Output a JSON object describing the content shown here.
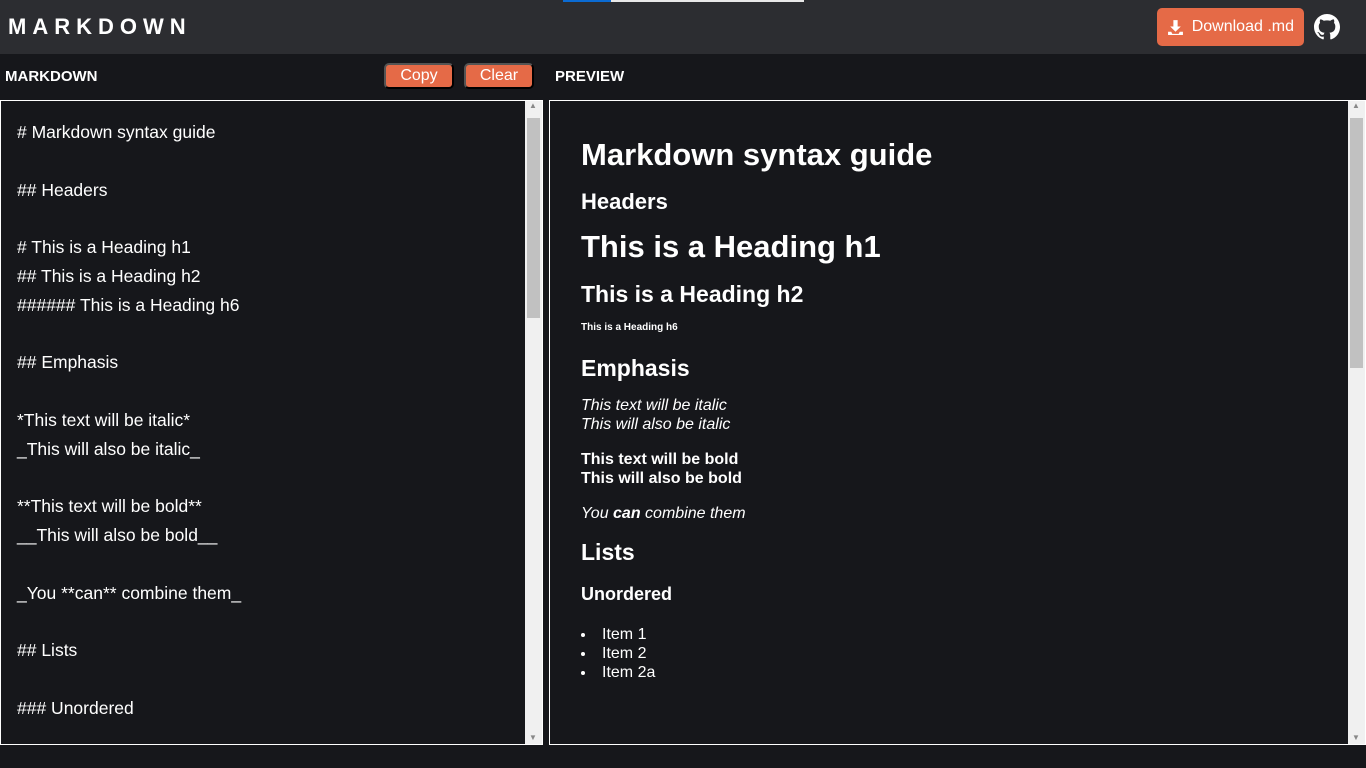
{
  "progress": 0.2,
  "header": {
    "logo": "MARKDOWN",
    "download_label": "Download .md",
    "download_icon": "download-icon",
    "github_icon": "github-icon"
  },
  "toolbar": {
    "markdown_label": "MARKDOWN",
    "copy_label": "Copy",
    "clear_label": "Clear",
    "preview_label": "PREVIEW"
  },
  "editor": {
    "text": "# Markdown syntax guide\n\n## Headers\n\n# This is a Heading h1\n## This is a Heading h2\n###### This is a Heading h6\n\n## Emphasis\n\n*This text will be italic*\n_This will also be italic_\n\n**This text will be bold**\n__This will also be bold__\n\n_You **can** combine them_\n\n## Lists\n\n### Unordered"
  },
  "preview": {
    "title": "Markdown syntax guide",
    "headers": "Headers",
    "h1": "This is a Heading h1",
    "h2": "This is a Heading h2",
    "h6": "This is a Heading h6",
    "emphasis": "Emphasis",
    "italic1": "This text will be italic",
    "italic2": "This will also be italic",
    "bold1": "This text will be bold",
    "bold2": "This will also be bold",
    "combine_pre": "You ",
    "combine_bold": "can",
    "combine_post": " combine them",
    "lists": "Lists",
    "unordered": "Unordered",
    "items": [
      "Item 1",
      "Item 2",
      "Item 2a"
    ]
  }
}
